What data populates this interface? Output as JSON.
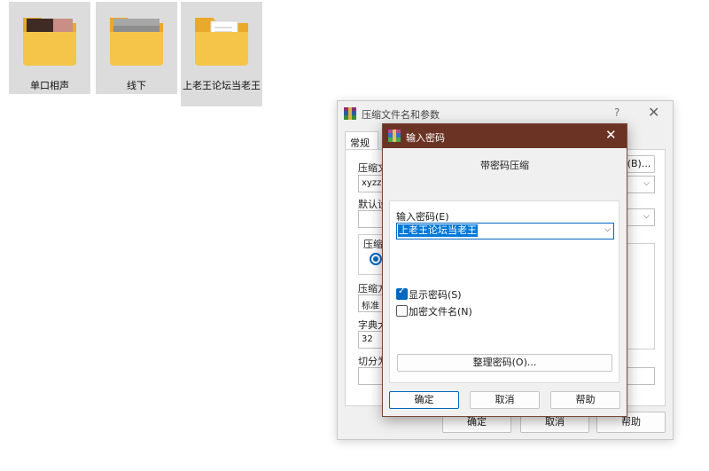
{
  "desktop": {
    "folders": [
      {
        "label": "单口相声",
        "icon": "folder-with-photo-icon"
      },
      {
        "label": "线下",
        "icon": "folder-with-gray-content-icon"
      },
      {
        "label": "上老王论坛当老王",
        "icon": "folder-with-document-icon"
      }
    ]
  },
  "archive_dialog": {
    "title": "压缩文件名和参数",
    "help_glyph": "?",
    "close_glyph": "✕",
    "tab_general": "常规",
    "archive_name_label": "压缩文",
    "archive_name_value": "xyzz.ra",
    "browse_label": "(B)...",
    "default_profile_label": "默认设",
    "format_label": "压缩",
    "method_label": "压缩方",
    "method_value": "标准",
    "dict_label": "字典大",
    "dict_value": "32",
    "split_label": "切分为",
    "ok_label": "确定",
    "cancel_label": "取消",
    "help_label": "帮助"
  },
  "password_dialog": {
    "title": "输入密码",
    "close_glyph": "✕",
    "subtitle": "带密码压缩",
    "password_label": "输入密码(E)",
    "password_value": "上老王论坛当老王",
    "show_password_label": "显示密码(S)",
    "show_password_checked": true,
    "encrypt_names_label": "加密文件名(N)",
    "encrypt_names_checked": false,
    "organize_label": "整理密码(O)...",
    "ok_label": "确定",
    "cancel_label": "取消",
    "help_label": "帮助"
  },
  "colors": {
    "title_bar": "#6b3324",
    "accent": "#0067c0",
    "selection": "#0078d7",
    "folder": "#f5c54a"
  }
}
